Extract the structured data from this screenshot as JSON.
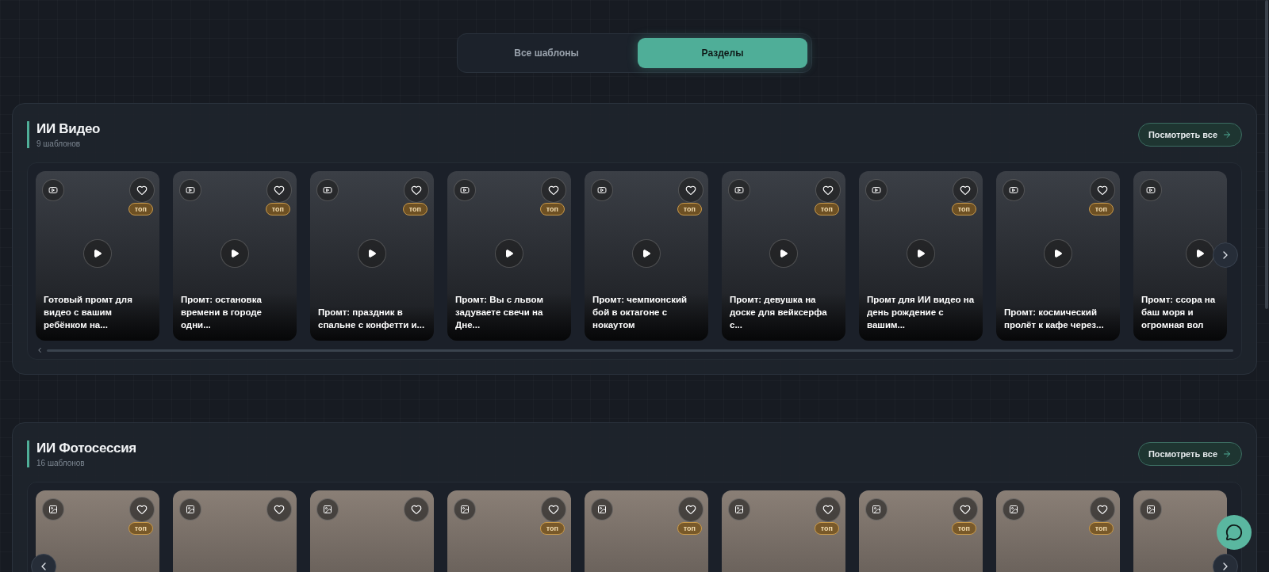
{
  "view_toggle": [
    {
      "label": "Все шаблоны",
      "selected": false
    },
    {
      "label": "Разделы",
      "selected": true
    }
  ],
  "sections": [
    {
      "title": "ИИ Видео",
      "count": "9 шаблонов",
      "view_all": "Посмотреть все",
      "kind": "video",
      "show_prev": false,
      "cards": [
        {
          "title": "Готовый промт для видео с вашим ребёнком на...",
          "badge": "топ",
          "partial": false
        },
        {
          "title": "Промт: остановка времени в городе одни...",
          "badge": "топ",
          "partial": false
        },
        {
          "title": "Промт: праздник в спальне с конфетти и...",
          "badge": "топ",
          "partial": false
        },
        {
          "title": "Промт: Вы с львом задуваете свечи на Дне...",
          "badge": "топ",
          "partial": false
        },
        {
          "title": "Промт: чемпионский бой в октагоне с нокаутом",
          "badge": "топ",
          "partial": false
        },
        {
          "title": "Промт: девушка на доске для вейксерфа с...",
          "badge": "топ",
          "partial": false
        },
        {
          "title": "Промт для ИИ видео на день рождение с вашим...",
          "badge": "топ",
          "partial": false
        },
        {
          "title": "Промт: космический пролёт к кафе через...",
          "badge": "топ",
          "partial": false
        },
        {
          "title": "Промт: ссора на баш моря и огромная вол",
          "partial": true
        }
      ]
    },
    {
      "title": "ИИ Фотосессия",
      "count": "16 шаблонов",
      "view_all": "Посмотреть все",
      "kind": "photo",
      "show_prev": true,
      "cards": [
        {
          "badge": "топ",
          "partial": false
        },
        {
          "partial": false
        },
        {
          "partial": false
        },
        {
          "badge": "топ",
          "partial": false
        },
        {
          "badge": "топ",
          "partial": false
        },
        {
          "badge": "топ",
          "partial": false
        },
        {
          "badge": "топ",
          "partial": false
        },
        {
          "badge": "топ",
          "partial": false
        },
        {
          "partial": true
        }
      ]
    }
  ]
}
